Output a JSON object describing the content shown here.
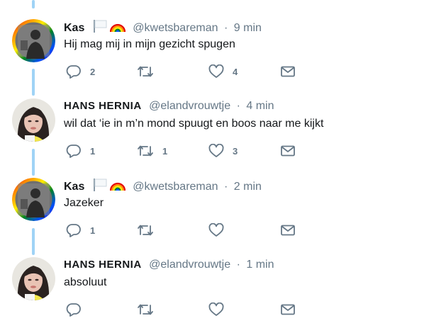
{
  "colors": {
    "text": "#14171a",
    "muted": "#657786",
    "thread": "#9fd3f6"
  },
  "tweets": [
    {
      "name": "Kas",
      "emoji": [
        "white-flag-icon",
        "rainbow-icon"
      ],
      "handle": "@kwetsbareman",
      "dot": "·",
      "time": "9 min",
      "text": "Hij mag mij in mijn gezicht spugen",
      "replies": "2",
      "retweets": "",
      "likes": "4"
    },
    {
      "name": "HANS HERNIA",
      "emoji": [],
      "handle": "@elandvrouwtje",
      "dot": "·",
      "time": "4 min",
      "text": "wil dat ‘ie in m’n mond spuugt en boos naar me kijkt",
      "replies": "1",
      "retweets": "1",
      "likes": "3"
    },
    {
      "name": "Kas",
      "emoji": [
        "white-flag-icon",
        "rainbow-icon"
      ],
      "handle": "@kwetsbareman",
      "dot": "·",
      "time": "2 min",
      "text": "Jazeker",
      "replies": "1",
      "retweets": "",
      "likes": ""
    },
    {
      "name": "HANS HERNIA",
      "emoji": [],
      "handle": "@elandvrouwtje",
      "dot": "·",
      "time": "1 min",
      "text": "absoluut",
      "replies": "",
      "retweets": "",
      "likes": ""
    }
  ]
}
